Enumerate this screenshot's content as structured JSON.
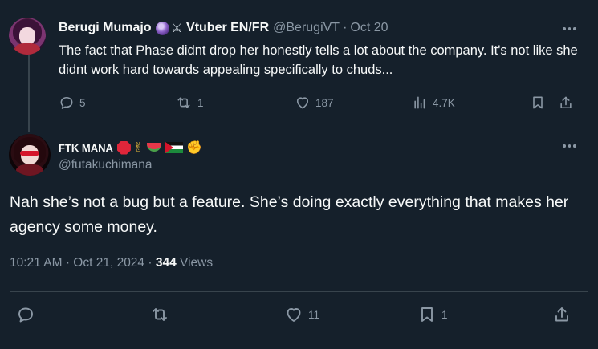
{
  "parent_tweet": {
    "display_name": "Berugi Mumajo",
    "name_suffix": "Vtuber EN/FR",
    "name_emoji": [
      "crystal-ball",
      "crossed-swords"
    ],
    "handle": "@BerugiVT",
    "separator": "·",
    "date": "Oct 20",
    "text": "The fact that Phase didnt drop her honestly tells a lot about the company. It's not like she didnt work hard towards appealing specifically to chuds...",
    "replies": "5",
    "reposts": "1",
    "likes": "187",
    "views": "4.7K"
  },
  "reply_tweet": {
    "display_name": "FTK MANA",
    "name_emoji": [
      "stop-sign",
      "sign-of-the-horns",
      "watermelon",
      "palestine-flag",
      "raised-fist"
    ],
    "handle": "@futakuchimana",
    "text": "Nah she’s not a bug but a feature. She’s doing exactly everything that makes her agency some money.",
    "time": "10:21 AM",
    "separator": "·",
    "date": "Oct 21, 2024",
    "separator2": "·",
    "views_count": "344",
    "views_label": "Views",
    "reposts": "",
    "likes": "11",
    "bookmarks": "1"
  },
  "colors": {
    "background": "#15202b",
    "text": "#f7f9f9",
    "muted": "#8b98a5",
    "divider": "#38444d"
  }
}
